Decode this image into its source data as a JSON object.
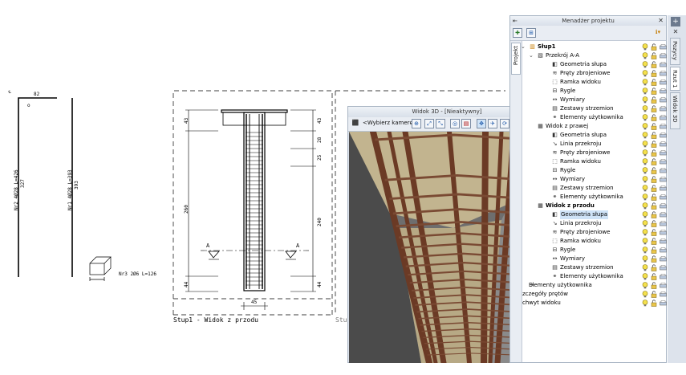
{
  "drawing": {
    "bar_n2_label": "Nr2 4Ø28 L=426",
    "bar_n2_dim": "82",
    "bar_n2_len": "327",
    "bar_n1_label": "Nr1 4Ø28 L=393",
    "bar_n1_len": "393",
    "stirrup_label": "Nr3 2Ø6 L=126",
    "dim_top_left": "43",
    "dim_mid_left": "260",
    "dim_bot_left": "44",
    "dim_bottom": "45",
    "dim_right_1": "43",
    "dim_right_2": "28",
    "dim_right_3": "25",
    "dim_right_4": "240",
    "dim_right_5": "44",
    "section_marker": "A",
    "view_caption": "Stup1 - Widok z przodu",
    "view_caption_2": "Stup"
  },
  "window3d": {
    "title": "Widok 3D - [Nieaktywny]",
    "camera_select": "<Wybierz kamerę>"
  },
  "project_manager": {
    "title": "Menadżer projektu",
    "side_tab": "Projekt",
    "tree": [
      {
        "label": "Słup1",
        "indent": 0,
        "bold": true,
        "toggle": "⌄",
        "icon": "column"
      },
      {
        "label": "Przekrój A-A",
        "indent": 1,
        "bold": false,
        "toggle": "⌄",
        "icon": "section"
      },
      {
        "label": "Geometria słupa",
        "indent": 2,
        "icon": "geometry"
      },
      {
        "label": "Pręty zbrojeniowe",
        "indent": 2,
        "icon": "rebar"
      },
      {
        "label": "Ramka widoku",
        "indent": 2,
        "icon": "frame"
      },
      {
        "label": "Rygle",
        "indent": 2,
        "icon": "beam"
      },
      {
        "label": "Wymiary",
        "indent": 2,
        "icon": "dimension"
      },
      {
        "label": "Zestawy strzemion",
        "indent": 2,
        "icon": "stirrup"
      },
      {
        "label": "Elementy użytkownika",
        "indent": 2,
        "icon": "user-element"
      },
      {
        "label": "Widok z prawej",
        "indent": 1,
        "icon": "view"
      },
      {
        "label": "Geometria słupa",
        "indent": 2,
        "icon": "geometry"
      },
      {
        "label": "Linia przekroju",
        "indent": 2,
        "icon": "section-line"
      },
      {
        "label": "Pręty zbrojeniowe",
        "indent": 2,
        "icon": "rebar"
      },
      {
        "label": "Ramka widoku",
        "indent": 2,
        "icon": "frame"
      },
      {
        "label": "Rygle",
        "indent": 2,
        "icon": "beam"
      },
      {
        "label": "Wymiary",
        "indent": 2,
        "icon": "dimension"
      },
      {
        "label": "Zestawy strzemion",
        "indent": 2,
        "icon": "stirrup"
      },
      {
        "label": "Elementy użytkownika",
        "indent": 2,
        "icon": "user-element"
      },
      {
        "label": "Widok z przodu",
        "indent": 1,
        "bold": true,
        "icon": "view"
      },
      {
        "label": "Geometria słupa",
        "indent": 2,
        "icon": "geometry",
        "highlight": true
      },
      {
        "label": "Linia przekroju",
        "indent": 2,
        "icon": "section-line"
      },
      {
        "label": "Pręty zbrojeniowe",
        "indent": 2,
        "icon": "rebar"
      },
      {
        "label": "Ramka widoku",
        "indent": 2,
        "icon": "frame"
      },
      {
        "label": "Rygle",
        "indent": 2,
        "icon": "beam"
      },
      {
        "label": "Wymiary",
        "indent": 2,
        "icon": "dimension"
      },
      {
        "label": "Zestawy strzemion",
        "indent": 2,
        "icon": "stirrup"
      },
      {
        "label": "Elementy użytkownika",
        "indent": 2,
        "icon": "user-element"
      },
      {
        "label": "Elementy użytkownika",
        "indent": 0,
        "icon": "user-element"
      },
      {
        "label": "zczegóły prętów",
        "indent": 0,
        "icon": "none"
      },
      {
        "label": "chwyt widoku",
        "indent": 0,
        "icon": "none"
      }
    ]
  },
  "right_tabs": [
    "Pozycy",
    "Rzut 1",
    "Widok 3D"
  ],
  "colors": {
    "bar_3d": "#6b3a25",
    "wall_3d": "#c8b996",
    "selected": "#cfe3f7"
  }
}
